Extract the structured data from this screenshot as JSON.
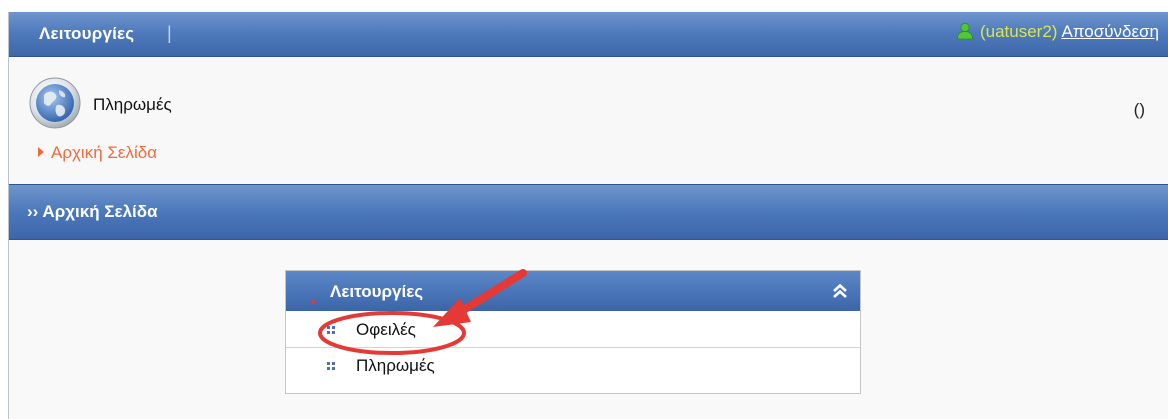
{
  "topbar": {
    "menu_label": "Λειτουργίες",
    "separator": "|",
    "user": "(uatuser2)",
    "logout": "Αποσύνδεση"
  },
  "header": {
    "app_title": "Πληρωμές",
    "home_link": "Αρχική Σελίδα",
    "right_text": "()"
  },
  "section": {
    "title": "›› Αρχική Σελίδα"
  },
  "panel": {
    "title": "Λειτουργίες",
    "items": [
      {
        "label": "Οφειλές"
      },
      {
        "label": "Πληρωμές"
      }
    ]
  },
  "colors": {
    "bar_blue": "#4f7bbd",
    "link_orange": "#f06a3c",
    "user_yellow": "#d9e64e",
    "annotation_red": "#e53935"
  }
}
